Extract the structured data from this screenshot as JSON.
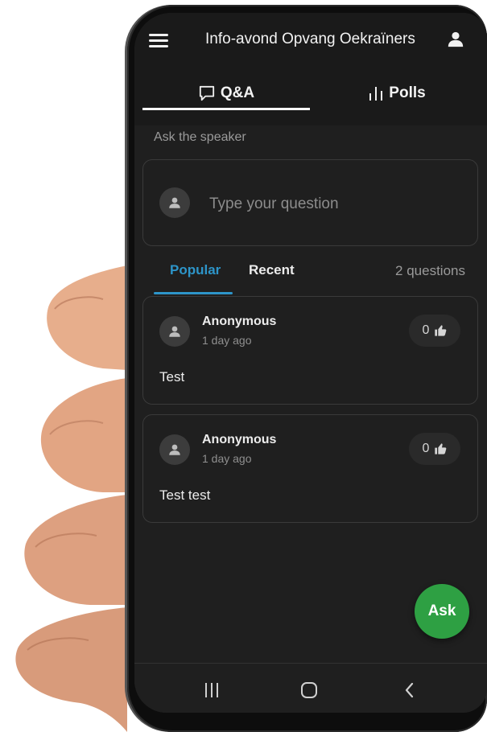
{
  "app": {
    "title": "Info-avond Opvang Oekraïners"
  },
  "tabs": {
    "qa_label": "Q&A",
    "polls_label": "Polls"
  },
  "ask": {
    "label": "Ask the speaker",
    "placeholder": "Type your question"
  },
  "filters": {
    "popular": "Popular",
    "recent": "Recent",
    "count": "2 questions"
  },
  "questions": [
    {
      "author": "Anonymous",
      "time": "1 day ago",
      "votes": "0",
      "text": "Test"
    },
    {
      "author": "Anonymous",
      "time": "1 day ago",
      "votes": "0",
      "text": "Test test"
    }
  ],
  "fab": {
    "label": "Ask"
  },
  "icons": {
    "menu": "hamburger-menu-icon",
    "user": "user-icon",
    "qa": "chat-bubble-icon",
    "polls": "bar-chart-icon",
    "avatar": "person-icon",
    "vote": "thumbs-up-icon",
    "nav_recent": "recent-apps-icon",
    "nav_home": "home-icon",
    "nav_back": "back-icon"
  },
  "colors": {
    "background": "#1f1f1f",
    "accent": "#2d95c9",
    "fab": "#2ea043",
    "text": "#ececec",
    "muted": "#9a9a9a"
  }
}
